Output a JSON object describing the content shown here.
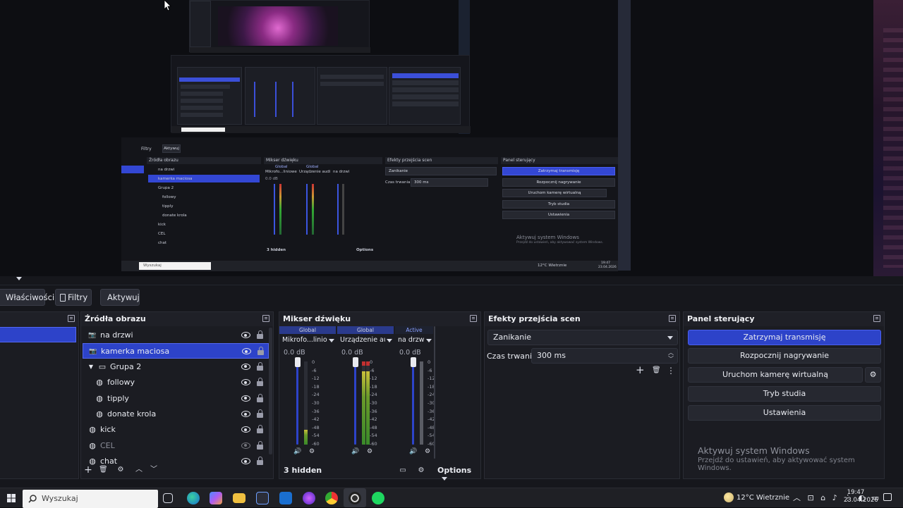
{
  "toolbar": {
    "properties": "Właściwości",
    "filters": "Filtry",
    "activate": "Aktywuj"
  },
  "sources": {
    "title": "Źródła obrazu",
    "items": [
      {
        "label": "na drzwi",
        "icon": "camera-icon"
      },
      {
        "label": "kamerka maciosa",
        "icon": "camera-icon"
      },
      {
        "label": "Grupa 2",
        "icon": "folder-icon"
      },
      {
        "label": "followy",
        "icon": "globe-icon"
      },
      {
        "label": "tipply",
        "icon": "globe-icon"
      },
      {
        "label": "donate krola",
        "icon": "globe-icon"
      },
      {
        "label": "kick",
        "icon": "globe-icon"
      },
      {
        "label": "CEL",
        "icon": "globe-icon"
      },
      {
        "label": "chat",
        "icon": "globe-icon"
      }
    ]
  },
  "mixer": {
    "title": "Mikser dźwięku",
    "channels": [
      {
        "header": "Global",
        "name": "Mikrofo...liniowe",
        "db": "0.0 dB"
      },
      {
        "header": "Global",
        "name": "Urządzenie audio",
        "db": "0.0 dB"
      },
      {
        "header": "Active",
        "name": "na drzwi",
        "db": "0.0 dB"
      }
    ],
    "scale": [
      "0",
      "-6",
      "-12",
      "-18",
      "-24",
      "-30",
      "-36",
      "-42",
      "-48",
      "-54",
      "-60"
    ],
    "hidden": "3 hidden",
    "options": "Options"
  },
  "transitions": {
    "title": "Efekty przejścia scen",
    "selected": "Zanikanie",
    "duration_label": "Czas trwania",
    "duration_value": "300 ms"
  },
  "controls": {
    "title": "Panel sterujący",
    "stop_stream": "Zatrzymaj transmisję",
    "start_record": "Rozpocznij nagrywanie",
    "virtual_cam": "Uruchom kamerę wirtualną",
    "studio_mode": "Tryb studia",
    "settings": "Ustawienia"
  },
  "watermark": {
    "line1": "Aktywuj system Windows",
    "line2": "Przejdź do ustawień, aby aktywować system Windows."
  },
  "taskbar": {
    "search": "Wyszukaj",
    "weather": "12°C Wietrznie",
    "time": "19:47",
    "date": "23.04.2026"
  },
  "nested": {
    "filters": "Filtry",
    "activate": "Aktywuj",
    "sources_title": "Źródła obrazu",
    "mixer_title": "Mikser dźwięku",
    "transitions_title": "Efekty przejścia scen",
    "controls_title": "Panel sterujący",
    "transition": "Zanikanie",
    "duration_label": "Czas trwania",
    "duration": "300 ms",
    "hidden": "3 hidden",
    "options": "Options",
    "search": "Wyszukaj",
    "weather": "12°C Wietrznie",
    "time": "19:47",
    "date": "23.04.2026",
    "mixer_names": [
      "Mikrofo...liniowe",
      "Urządzenie audi",
      "na drzwi"
    ],
    "mixer_heads": [
      "Global",
      "Global"
    ],
    "mixer_db": "0.0 dB",
    "sources": [
      "na drzwi",
      "kamerka maciosa",
      "Grupa 2",
      "followy",
      "tipply",
      "donate krola",
      "kick",
      "CEL",
      "chat"
    ],
    "buttons": [
      "Zatrzymaj transmisję",
      "Rozpocznij nagrywanie",
      "Uruchom kamerę wirtualną",
      "Tryb studia",
      "Ustawienia"
    ],
    "wm1": "Aktywuj system Windows",
    "wm2": "Przejdź do ustawień, aby aktywować system Windows."
  }
}
